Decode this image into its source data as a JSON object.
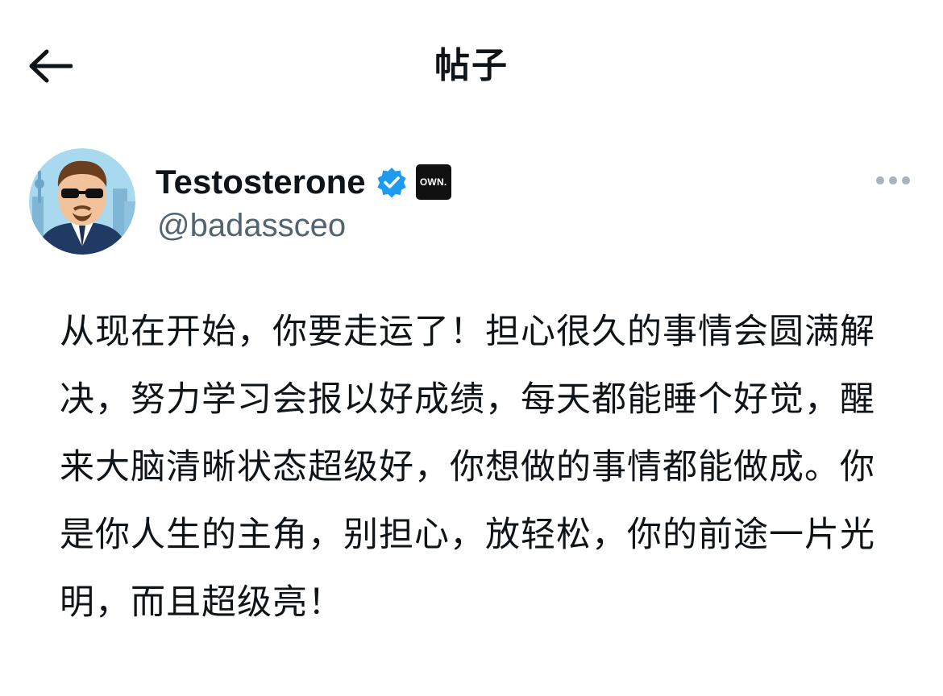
{
  "header": {
    "title": "帖子",
    "back_icon": "arrow-left-icon"
  },
  "author": {
    "display_name": "Testosterone",
    "handle": "@badassceo",
    "verified_icon": "verified-badge-icon",
    "verified_color": "#1d9bf0",
    "affiliate_badge_text": "OWN.",
    "avatar_icon": "avatar-cartoon-businessman"
  },
  "post": {
    "text": "从现在开始，你要走运了！担心很久的事情会圆满解决，努力学习会报以好成绩，每天都能睡个好觉，醒来大脑清晰状态超级好，你想做的事情都能做成。你是你人生的主角，别担心，放轻松，你的前途一片光明，而且超级亮！"
  },
  "colors": {
    "text_primary": "#0f1419",
    "text_secondary": "#536471",
    "background": "#ffffff"
  },
  "more_icon": "more-horizontal-icon"
}
